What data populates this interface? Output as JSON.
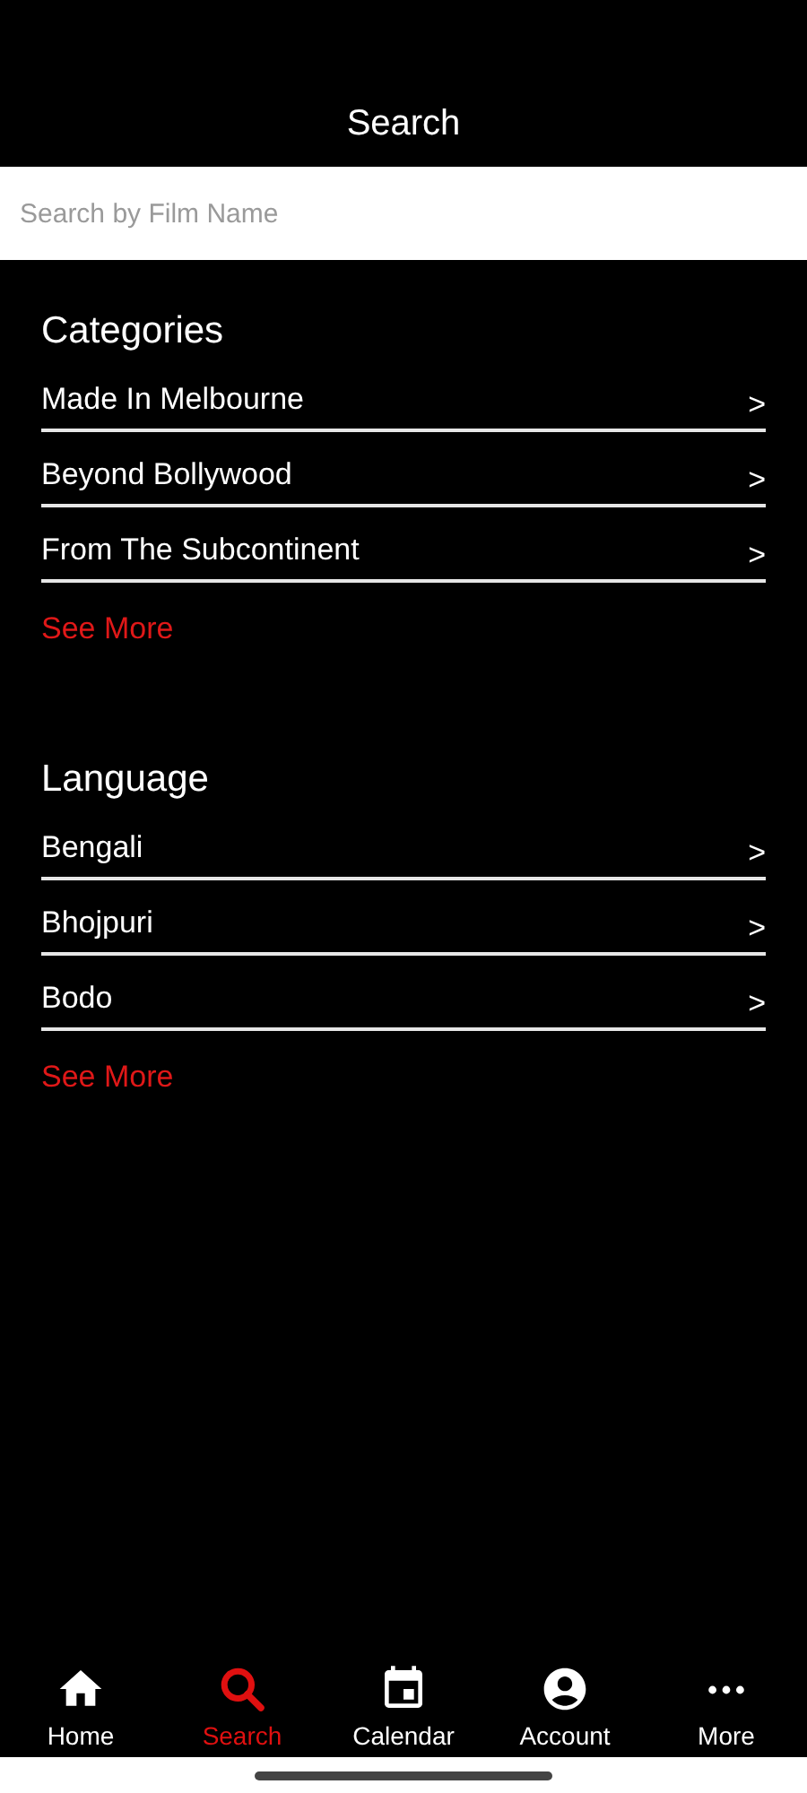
{
  "header": {
    "title": "Search"
  },
  "search": {
    "placeholder": "Search by Film Name"
  },
  "sections": [
    {
      "heading": "Categories",
      "items": [
        {
          "label": "Made In Melbourne",
          "arrow": ">"
        },
        {
          "label": "Beyond Bollywood",
          "arrow": ">"
        },
        {
          "label": "From The Subcontinent",
          "arrow": ">"
        }
      ],
      "see_more": "See More"
    },
    {
      "heading": "Language",
      "items": [
        {
          "label": "Bengali",
          "arrow": ">"
        },
        {
          "label": "Bhojpuri",
          "arrow": ">"
        },
        {
          "label": "Bodo",
          "arrow": ">"
        }
      ],
      "see_more": "See More"
    }
  ],
  "tabs": [
    {
      "kind": "home",
      "label": "Home",
      "selected": false
    },
    {
      "kind": "search",
      "label": "Search",
      "selected": true
    },
    {
      "kind": "calendar",
      "label": "Calendar",
      "selected": false
    },
    {
      "kind": "account",
      "label": "Account",
      "selected": false
    },
    {
      "kind": "more",
      "label": "More",
      "selected": false
    }
  ]
}
